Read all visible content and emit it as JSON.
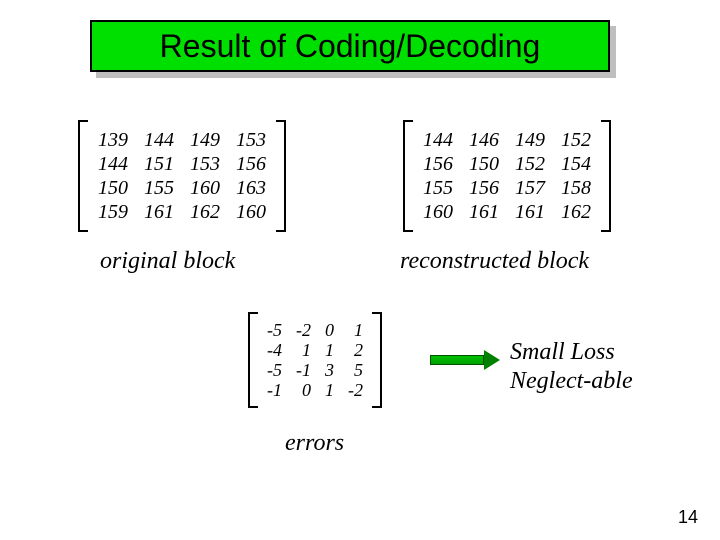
{
  "title": "Result of Coding/Decoding",
  "original": {
    "caption": "original block",
    "rows": [
      [
        "139",
        "144",
        "149",
        "153"
      ],
      [
        "144",
        "151",
        "153",
        "156"
      ],
      [
        "150",
        "155",
        "160",
        "163"
      ],
      [
        "159",
        "161",
        "162",
        "160"
      ]
    ]
  },
  "reconstructed": {
    "caption": "reconstructed block",
    "rows": [
      [
        "144",
        "146",
        "149",
        "152"
      ],
      [
        "156",
        "150",
        "152",
        "154"
      ],
      [
        "155",
        "156",
        "157",
        "158"
      ],
      [
        "160",
        "161",
        "161",
        "162"
      ]
    ]
  },
  "errors": {
    "caption": "errors",
    "rows": [
      [
        "-5",
        "-2",
        "0",
        "1"
      ],
      [
        "-4",
        "1",
        "1",
        "2"
      ],
      [
        "-5",
        "-1",
        "3",
        "5"
      ],
      [
        "-1",
        "0",
        "1",
        "-2"
      ]
    ]
  },
  "note_line1": "Small Loss",
  "note_line2": "Neglect-able",
  "page_number": "14"
}
